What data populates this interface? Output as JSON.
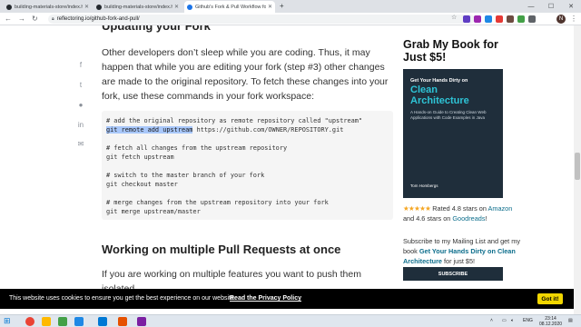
{
  "browser": {
    "tabs": [
      {
        "label": "building-materials-store/index.h",
        "favicon_color": "#24292e",
        "active": false
      },
      {
        "label": "building-materials-store/index.h",
        "favicon_color": "#24292e",
        "active": false
      },
      {
        "label": "Github's Fork & Pull Workflow fo",
        "favicon_color": "#1a73e8",
        "active": true
      }
    ],
    "new_tab_icon": "plus-icon",
    "url": "reflectoring.io/github-fork-and-pull/",
    "profile_initial": "N",
    "extension_colors": [
      "#5f3dc4",
      "#9c27b0",
      "#1e88e5",
      "#e53935",
      "#6d4c41",
      "#43a047",
      "#5f6368"
    ]
  },
  "page": {
    "section_heading_1": "Updating your Fork",
    "intro_paragraph": "Other developers don’t sleep while you are coding. Thus, it may happen that while you are editing your fork (step #3) other changes are made to the original repository. To fetch these changes into your fork, use these commands in your fork workspace:",
    "code_block": {
      "line1": "# add the original repository as remote repository called \"upstream\"",
      "line2_selected": "git remote add upstream",
      "line2_rest": " https://github.com/OWNER/REPOSITORY.git",
      "line3": "# fetch all changes from the upstream repository",
      "line4": "git fetch upstream",
      "line5": "# switch to the master branch of your fork",
      "line6": "git checkout master",
      "line7": "# merge changes from the upstream repository into your fork",
      "line8": "git merge upstream/master"
    },
    "section_heading_2": "Working on multiple Pull Requests at once",
    "second_paragraph": "If you are working on multiple features you want to push them isolated",
    "share_icons": [
      "facebook-icon",
      "twitter-icon",
      "reddit-icon",
      "linkedin-icon",
      "email-icon"
    ]
  },
  "sidebar": {
    "title": "Grab My Book for Just $5!",
    "book": {
      "subtitle_top": "Get Your Hands Dirty on",
      "title": "Clean Architecture",
      "tagline": "A Hands-on Guide to Creating Clean Web Applications with Code Examples in Java",
      "author": "Tom Hombergs"
    },
    "rating_stars": "★★★★★",
    "rating_text_1": " Rated 4.8 stars on ",
    "rating_link_1": "Amazon",
    "rating_text_2": " and 4.6 stars on ",
    "rating_link_2": "Goodreads",
    "rating_text_3": "!",
    "subscribe_text_1": "Subscribe to my Mailing List and get my book ",
    "subscribe_link": "Get Your Hands Dirty on Clean Architecture",
    "subscribe_text_2": " for just $5!",
    "subscribe_button": "SUBSCRIBE"
  },
  "cookie_banner": {
    "message": "This website uses cookies to ensure you get the best experience on our website.",
    "privacy_link": "Read the Privacy Policy",
    "button": "Got it!"
  },
  "taskbar": {
    "tray_language": "ENG",
    "time": "23:14",
    "date": "08.12.2020",
    "icon_colors": [
      "#0078d4",
      "#ffb900",
      "#1e88e5",
      "#43a047",
      "#ea4335",
      "#e65100",
      "#7b1fa2",
      "#0078d4",
      "#ff6f00"
    ]
  }
}
